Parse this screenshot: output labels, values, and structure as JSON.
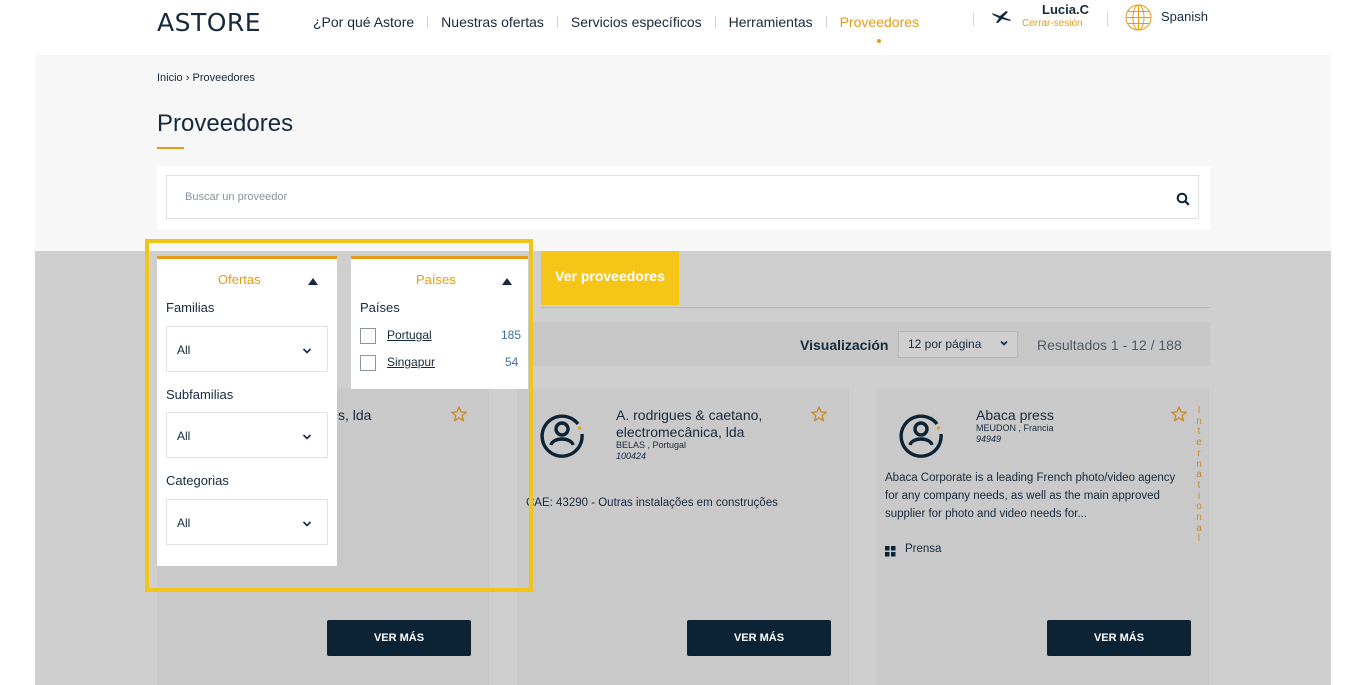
{
  "header": {
    "logo": "ASTORE",
    "nav": [
      {
        "label": "¿Por qué Astore",
        "active": false
      },
      {
        "label": "Nuestras ofertas",
        "active": false
      },
      {
        "label": "Servicios específicos",
        "active": false
      },
      {
        "label": "Herramientas",
        "active": false
      },
      {
        "label": "Proveedores",
        "active": true
      }
    ],
    "user_name": "Lucia.C",
    "logout": "Cerrar-sesión",
    "language": "Spanish"
  },
  "breadcrumb": {
    "home": "Inicio",
    "sep": "›",
    "current": "Proveedores"
  },
  "page_title": "Proveedores",
  "search": {
    "placeholder": "Buscar un proveedor"
  },
  "filters": {
    "ofertas": {
      "title": "Ofertas",
      "familias": {
        "label": "Familias",
        "value": "All"
      },
      "subfamilias": {
        "label": "Subfamilias",
        "value": "All"
      },
      "categorias": {
        "label": "Categorias",
        "value": "All"
      }
    },
    "paises": {
      "title": "Países",
      "label": "Países",
      "options": [
        {
          "label": "Portugal",
          "count": "185",
          "checked": false
        },
        {
          "label": "Singapur",
          "count": "54",
          "checked": false
        }
      ]
    },
    "apply_button": "Ver proveedores"
  },
  "toolbar": {
    "visualizacion": "Visualización",
    "per_page": "12 por página",
    "results": "Resultados 1 - 12 / 188"
  },
  "cards": [
    {
      "title_partial": "s, lda",
      "button": "VER MÁS"
    },
    {
      "title": "A. rodrigues & caetano, electromecânica, lda",
      "location": "BELAS , Portugal",
      "id": "100424",
      "description": "CAE: 43290 - Outras instalações em construções",
      "button": "VER MÁS"
    },
    {
      "title": "Abaca press",
      "location": "MEUDON , Francia",
      "id": "94949",
      "description": "Abaca Corporate is a leading French photo/video agency for any company needs, as well as the main approved supplier for photo and video needs for...",
      "tag": "Prensa",
      "badge": "International",
      "button": "VER MÁS"
    }
  ],
  "colors": {
    "accent": "#e59c14",
    "dark": "#0c2336",
    "highlight": "#f2c418"
  }
}
